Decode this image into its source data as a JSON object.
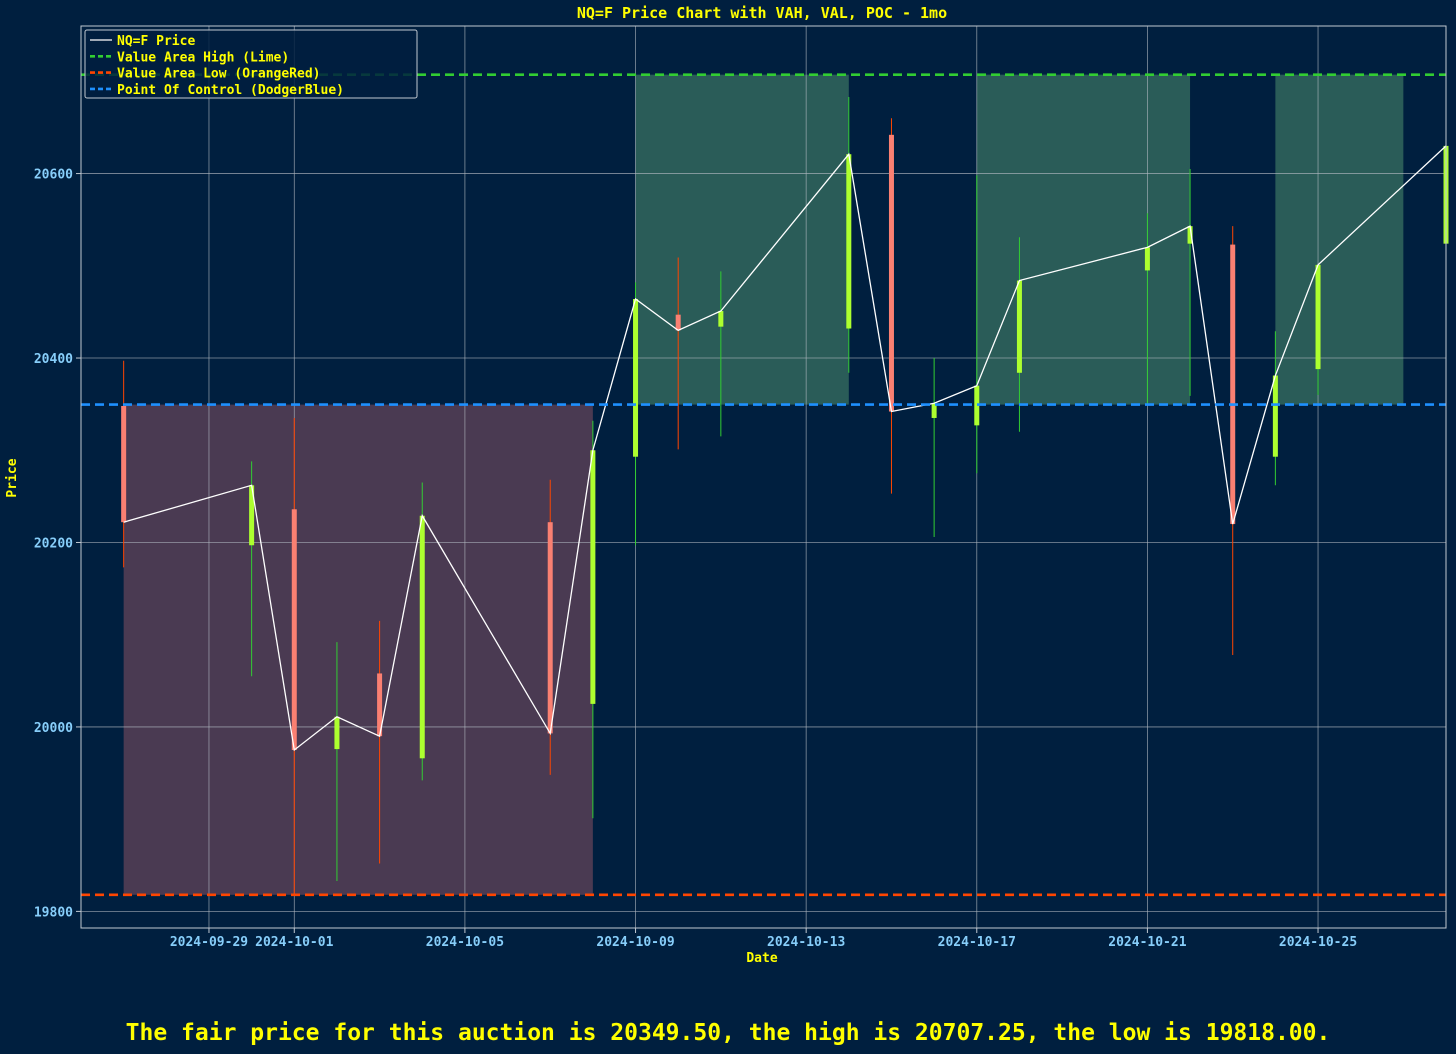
{
  "chart_data": {
    "type": "candlestick",
    "title": "NQ=F Price Chart with VAH, VAL, POC - 1mo",
    "xlabel": "Date",
    "ylabel": "Price",
    "ylim": [
      19782,
      20760
    ],
    "xlim": [
      "2024-09-26",
      "2024-10-28"
    ],
    "yticks": [
      19800,
      20000,
      20200,
      20400,
      20600
    ],
    "xticks": [
      "2024-09-29",
      "2024-10-01",
      "2024-10-05",
      "2024-10-09",
      "2024-10-13",
      "2024-10-17",
      "2024-10-21",
      "2024-10-25"
    ],
    "grid": true,
    "legend_position": "top-left",
    "legend": [
      {
        "label": "NQ=F Price",
        "color": "#ffffff",
        "style": "solid"
      },
      {
        "label": "Value Area High (Lime)",
        "color": "#32cd32",
        "style": "dashed"
      },
      {
        "label": "Value Area Low (OrangeRed)",
        "color": "#ff4500",
        "style": "dashed"
      },
      {
        "label": "Point Of Control (DodgerBlue)",
        "color": "#1e90ff",
        "style": "dashed"
      }
    ],
    "levels": {
      "vah": 20707.25,
      "val": 19818.0,
      "poc": 20349.5
    },
    "shaded_regions": [
      {
        "start": "2024-09-27",
        "end": "2024-10-08",
        "low": 19818.0,
        "high": 20349.5,
        "color": "#4a3a52"
      },
      {
        "start": "2024-10-09",
        "end": "2024-10-14",
        "low": 20349.5,
        "high": 20707.25,
        "color": "#2a5c58"
      },
      {
        "start": "2024-10-17",
        "end": "2024-10-22",
        "low": 20349.5,
        "high": 20707.25,
        "color": "#2a5c58"
      },
      {
        "start": "2024-10-24",
        "end": "2024-10-27",
        "low": 20349.5,
        "high": 20707.25,
        "color": "#2a5c58"
      }
    ],
    "candles": [
      {
        "date": "2024-09-27",
        "open": 20348,
        "high": 20397,
        "low": 20173,
        "close": 20222
      },
      {
        "date": "2024-09-30",
        "open": 20197,
        "high": 20288,
        "low": 20055,
        "close": 20262
      },
      {
        "date": "2024-10-01",
        "open": 20236,
        "high": 20335,
        "low": 19818,
        "close": 19975
      },
      {
        "date": "2024-10-02",
        "open": 19976,
        "high": 20092,
        "low": 19833,
        "close": 20011
      },
      {
        "date": "2024-10-03",
        "open": 20058,
        "high": 20115,
        "low": 19852,
        "close": 19990
      },
      {
        "date": "2024-10-04",
        "open": 19966,
        "high": 20265,
        "low": 19942,
        "close": 20229
      },
      {
        "date": "2024-10-07",
        "open": 20222,
        "high": 20268,
        "low": 19948,
        "close": 19993
      },
      {
        "date": "2024-10-08",
        "open": 20025,
        "high": 20332,
        "low": 19901,
        "close": 20300
      },
      {
        "date": "2024-10-09",
        "open": 20293,
        "high": 20482,
        "low": 20197,
        "close": 20464
      },
      {
        "date": "2024-10-10",
        "open": 20447,
        "high": 20509,
        "low": 20301,
        "close": 20430
      },
      {
        "date": "2024-10-11",
        "open": 20434,
        "high": 20494,
        "low": 20315,
        "close": 20451
      },
      {
        "date": "2024-10-14",
        "open": 20432,
        "high": 20683,
        "low": 20384,
        "close": 20621
      },
      {
        "date": "2024-10-15",
        "open": 20642,
        "high": 20660,
        "low": 20253,
        "close": 20342
      },
      {
        "date": "2024-10-16",
        "open": 20335,
        "high": 20400,
        "low": 20206,
        "close": 20351
      },
      {
        "date": "2024-10-17",
        "open": 20327,
        "high": 20598,
        "low": 20275,
        "close": 20370
      },
      {
        "date": "2024-10-18",
        "open": 20384,
        "high": 20531,
        "low": 20320,
        "close": 20484
      },
      {
        "date": "2024-10-21",
        "open": 20495,
        "high": 20557,
        "low": 20350,
        "close": 20520
      },
      {
        "date": "2024-10-22",
        "open": 20524,
        "high": 20605,
        "low": 20359,
        "close": 20543
      },
      {
        "date": "2024-10-23",
        "open": 20523,
        "high": 20543,
        "low": 20078,
        "close": 20220
      },
      {
        "date": "2024-10-24",
        "open": 20293,
        "high": 20429,
        "low": 20262,
        "close": 20381
      },
      {
        "date": "2024-10-25",
        "open": 20388,
        "high": 20501,
        "low": 20360,
        "close": 20501
      },
      {
        "date": "2024-10-28",
        "open": 20524,
        "high": 20651,
        "low": 20474,
        "close": 20630
      }
    ]
  },
  "footer": {
    "text": "The fair price for this auction is 20349.50, the high is 20707.25, the low is 19818.00."
  },
  "colors": {
    "background": "#001f3f",
    "title": "#ffff00",
    "axis_label": "#ffff00",
    "tick_label": "#87cefa",
    "grid": "#b0b8c0",
    "up_candle": "#adff2f",
    "up_wick": "#32cd32",
    "down_candle": "#fa8072",
    "down_wick": "#ff4500",
    "price_line": "#ffffff"
  }
}
